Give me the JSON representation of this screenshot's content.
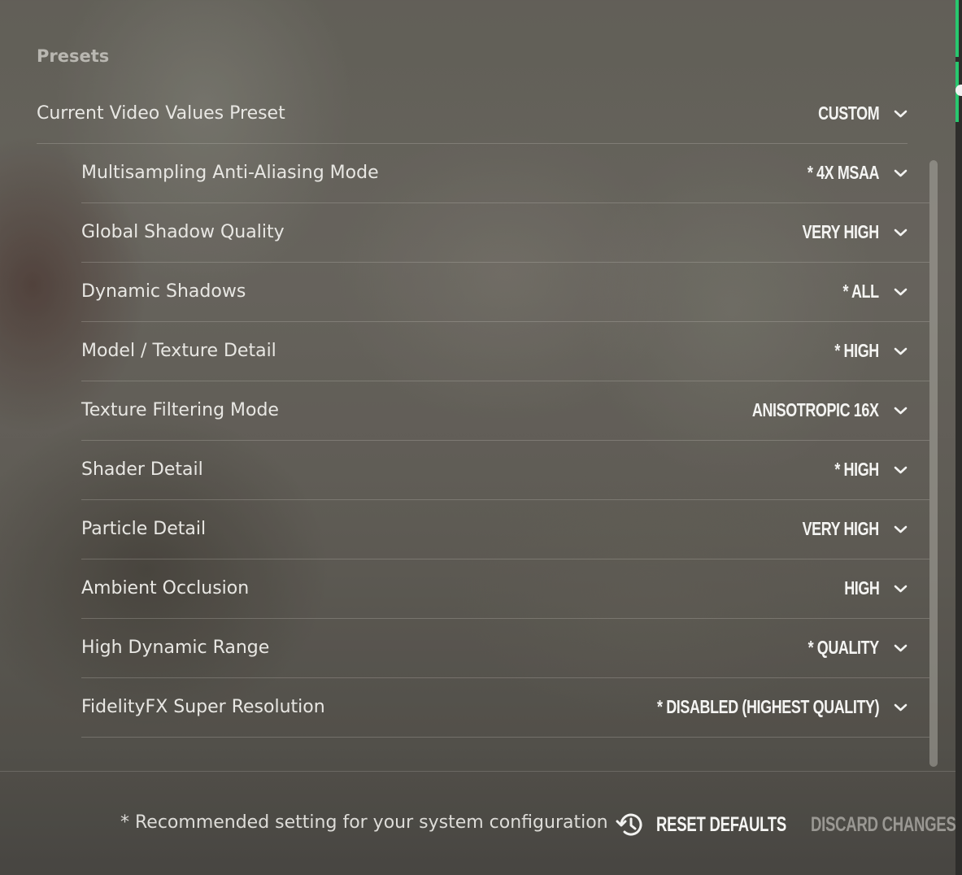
{
  "colors": {
    "accent": "#28c76f",
    "text": "#e8e7e3",
    "muted": "#9a9893"
  },
  "section": {
    "title": "Presets"
  },
  "preset": {
    "label": "Current Video Values Preset",
    "value": "CUSTOM",
    "icon": "chevron-down-icon"
  },
  "settings": [
    {
      "label": "Multisampling Anti-Aliasing Mode",
      "value": "* 4X MSAA"
    },
    {
      "label": "Global Shadow Quality",
      "value": "VERY HIGH"
    },
    {
      "label": "Dynamic Shadows",
      "value": "* ALL"
    },
    {
      "label": "Model / Texture Detail",
      "value": "* HIGH"
    },
    {
      "label": "Texture Filtering Mode",
      "value": "ANISOTROPIC 16X"
    },
    {
      "label": "Shader Detail",
      "value": "* HIGH"
    },
    {
      "label": "Particle Detail",
      "value": "VERY HIGH"
    },
    {
      "label": "Ambient Occlusion",
      "value": "HIGH"
    },
    {
      "label": "High Dynamic Range",
      "value": "* QUALITY"
    },
    {
      "label": "FidelityFX Super Resolution",
      "value": "* DISABLED (HIGHEST QUALITY)"
    }
  ],
  "footer": {
    "note": "* Recommended setting for your system configuration",
    "reset_label": "RESET DEFAULTS",
    "reset_icon": "history-icon",
    "discard_label": "DISCARD CHANGES"
  }
}
